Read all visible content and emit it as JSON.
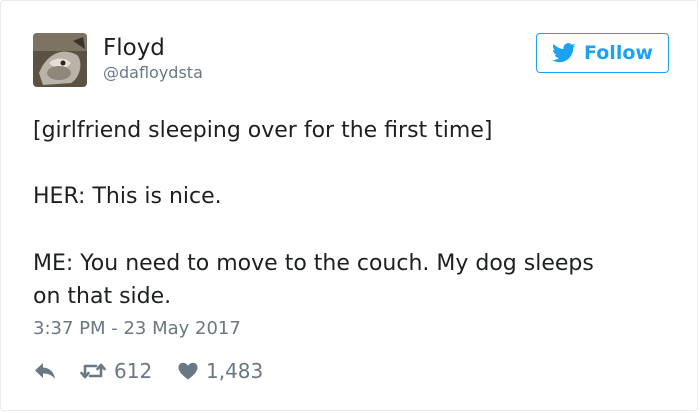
{
  "user": {
    "display_name": "Floyd",
    "handle": "@dafloydsta"
  },
  "follow_button": {
    "label": "Follow",
    "icon": "twitter-bird-icon"
  },
  "tweet": {
    "lines": [
      "[girlfriend sleeping over for the first time]",
      "HER: This is nice.",
      "ME: You need to move to the couch. My dog sleeps",
      "on that side."
    ],
    "timestamp": "3:37 PM - 23 May 2017"
  },
  "actions": {
    "reply_icon": "reply-icon",
    "retweet_icon": "retweet-icon",
    "retweet_count": "612",
    "like_icon": "heart-icon",
    "like_count": "1,483"
  },
  "colors": {
    "accent": "#1da1f2",
    "text": "#1c2022",
    "muted": "#697882",
    "border": "#e6ecf0"
  }
}
